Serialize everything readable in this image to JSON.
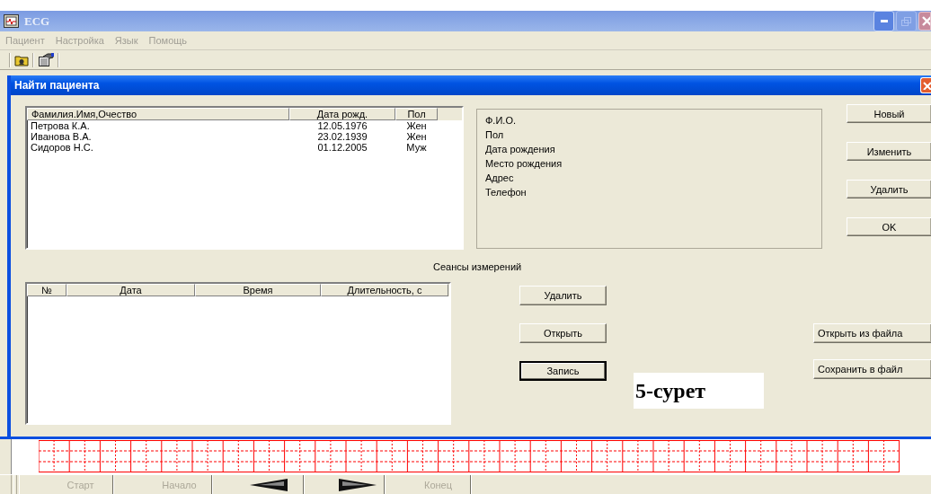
{
  "window": {
    "title": "ECG",
    "active": false
  },
  "menu": [
    {
      "label": "Пациент",
      "disabled": true
    },
    {
      "label": "Настройка",
      "disabled": true
    },
    {
      "label": "Язык",
      "disabled": true
    },
    {
      "label": "Помощь",
      "disabled": true
    }
  ],
  "dialog": {
    "title": "Найти пациента",
    "patients": {
      "columns": [
        "Фамилия.Имя,Очество",
        "Дата рожд.",
        "Пол"
      ],
      "rows": [
        [
          "Петрова К.А.",
          "12.05.1976",
          "Жен"
        ],
        [
          "Иванова В.А.",
          "23.02.1939",
          "Жен"
        ],
        [
          "Сидоров Н.С.",
          "01.12.2005",
          "Муж"
        ]
      ]
    },
    "details": [
      "Ф.И.О.",
      "Пол",
      "Дата рождения",
      "Место рождения",
      "Адрес",
      "Телефон"
    ],
    "patient_buttons": [
      "Новый",
      "Изменить",
      "Удалить",
      "OK"
    ],
    "sessions_label": "Сеансы измерений",
    "sessions": {
      "columns": [
        "№",
        "Дата",
        "Время",
        "Длительность, с"
      ]
    },
    "session_buttons": [
      {
        "label": "Удалить",
        "default": false
      },
      {
        "label": "Открыть",
        "default": false
      },
      {
        "label": "Запись",
        "default": true
      }
    ],
    "file_buttons": [
      "Открыть из файла",
      "Сохранить в файл"
    ]
  },
  "playback": [
    {
      "kind": "text",
      "label": "Старт",
      "disabled": true
    },
    {
      "kind": "text",
      "label": "Начало",
      "disabled": true
    },
    {
      "kind": "arrow-left",
      "disabled": false
    },
    {
      "kind": "arrow-right",
      "disabled": false
    },
    {
      "kind": "text",
      "label": "Конец",
      "disabled": true
    }
  ],
  "figure_label": "5-сурет"
}
